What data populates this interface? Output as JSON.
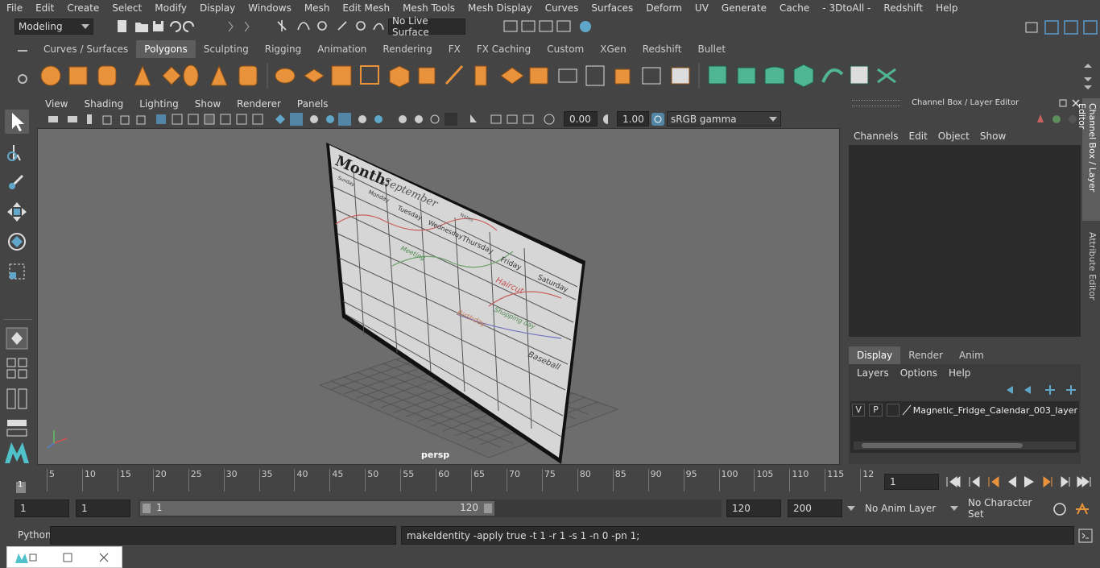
{
  "menubar": {
    "items": [
      "File",
      "Edit",
      "Create",
      "Select",
      "Modify",
      "Display",
      "Windows",
      "Mesh",
      "Edit Mesh",
      "Mesh Tools",
      "Mesh Display",
      "Curves",
      "Surfaces",
      "Deform",
      "UV",
      "Generate",
      "Cache",
      "- 3DtoAll -",
      "Redshift",
      "Help"
    ]
  },
  "statusline": {
    "mode": "Modeling",
    "live_surface": "No Live Surface"
  },
  "shelf_tabs": {
    "items": [
      "Curves / Surfaces",
      "Polygons",
      "Sculpting",
      "Rigging",
      "Animation",
      "Rendering",
      "FX",
      "FX Caching",
      "Custom",
      "XGen",
      "Redshift",
      "Bullet"
    ],
    "active": "Polygons"
  },
  "viewport": {
    "menu": [
      "View",
      "Shading",
      "Lighting",
      "Show",
      "Renderer",
      "Panels"
    ],
    "exposure": "0.00",
    "gamma": "1.00",
    "color_space": "sRGB gamma",
    "camera_label": "persp",
    "calendar": {
      "month_label": "Month:",
      "month_value": "September",
      "days": [
        "Sunday",
        "Monday",
        "Tuesday",
        "Wednesday",
        "Thursday",
        "Friday",
        "Saturday"
      ],
      "notes_label": "Notes",
      "entries": [
        "Haircut",
        "Shopping day",
        "Baseball",
        "Birthday",
        "Meeting"
      ]
    }
  },
  "channel_box": {
    "title": "Channel Box / Layer Editor",
    "menu": [
      "Channels",
      "Edit",
      "Object",
      "Show"
    ],
    "layer_tabs": [
      "Display",
      "Render",
      "Anim"
    ],
    "active_layer_tab": "Display",
    "layer_menu": [
      "Layers",
      "Options",
      "Help"
    ],
    "layer": {
      "v": "V",
      "p": "P",
      "name": "Magnetic_Fridge_Calendar_003_layer"
    }
  },
  "side_tabs": [
    "Channel Box / Layer Editor",
    "Attribute Editor"
  ],
  "timeline": {
    "ticks": [
      "5",
      "10",
      "15",
      "20",
      "25",
      "30",
      "35",
      "40",
      "45",
      "50",
      "55",
      "60",
      "65",
      "70",
      "75",
      "80",
      "85",
      "90",
      "95",
      "100",
      "105",
      "110",
      "115",
      "12"
    ],
    "start_marker": "1",
    "current_frame": "1"
  },
  "range": {
    "start": "1",
    "start2": "1",
    "slider_start": "1",
    "slider_end": "120",
    "end": "120",
    "end2": "200",
    "anim_layer": "No Anim Layer",
    "character_set": "No Character Set"
  },
  "command_line": {
    "label": "Python",
    "output": "makeIdentity -apply true -t 1 -r 1 -s 1 -n 0 -pn 1;"
  },
  "colors": {
    "accent_blue": "#5285a6",
    "shelf_orange": "#e8923c",
    "shelf_green": "#4fb592",
    "viewport_bg": "#6d6d6d"
  }
}
